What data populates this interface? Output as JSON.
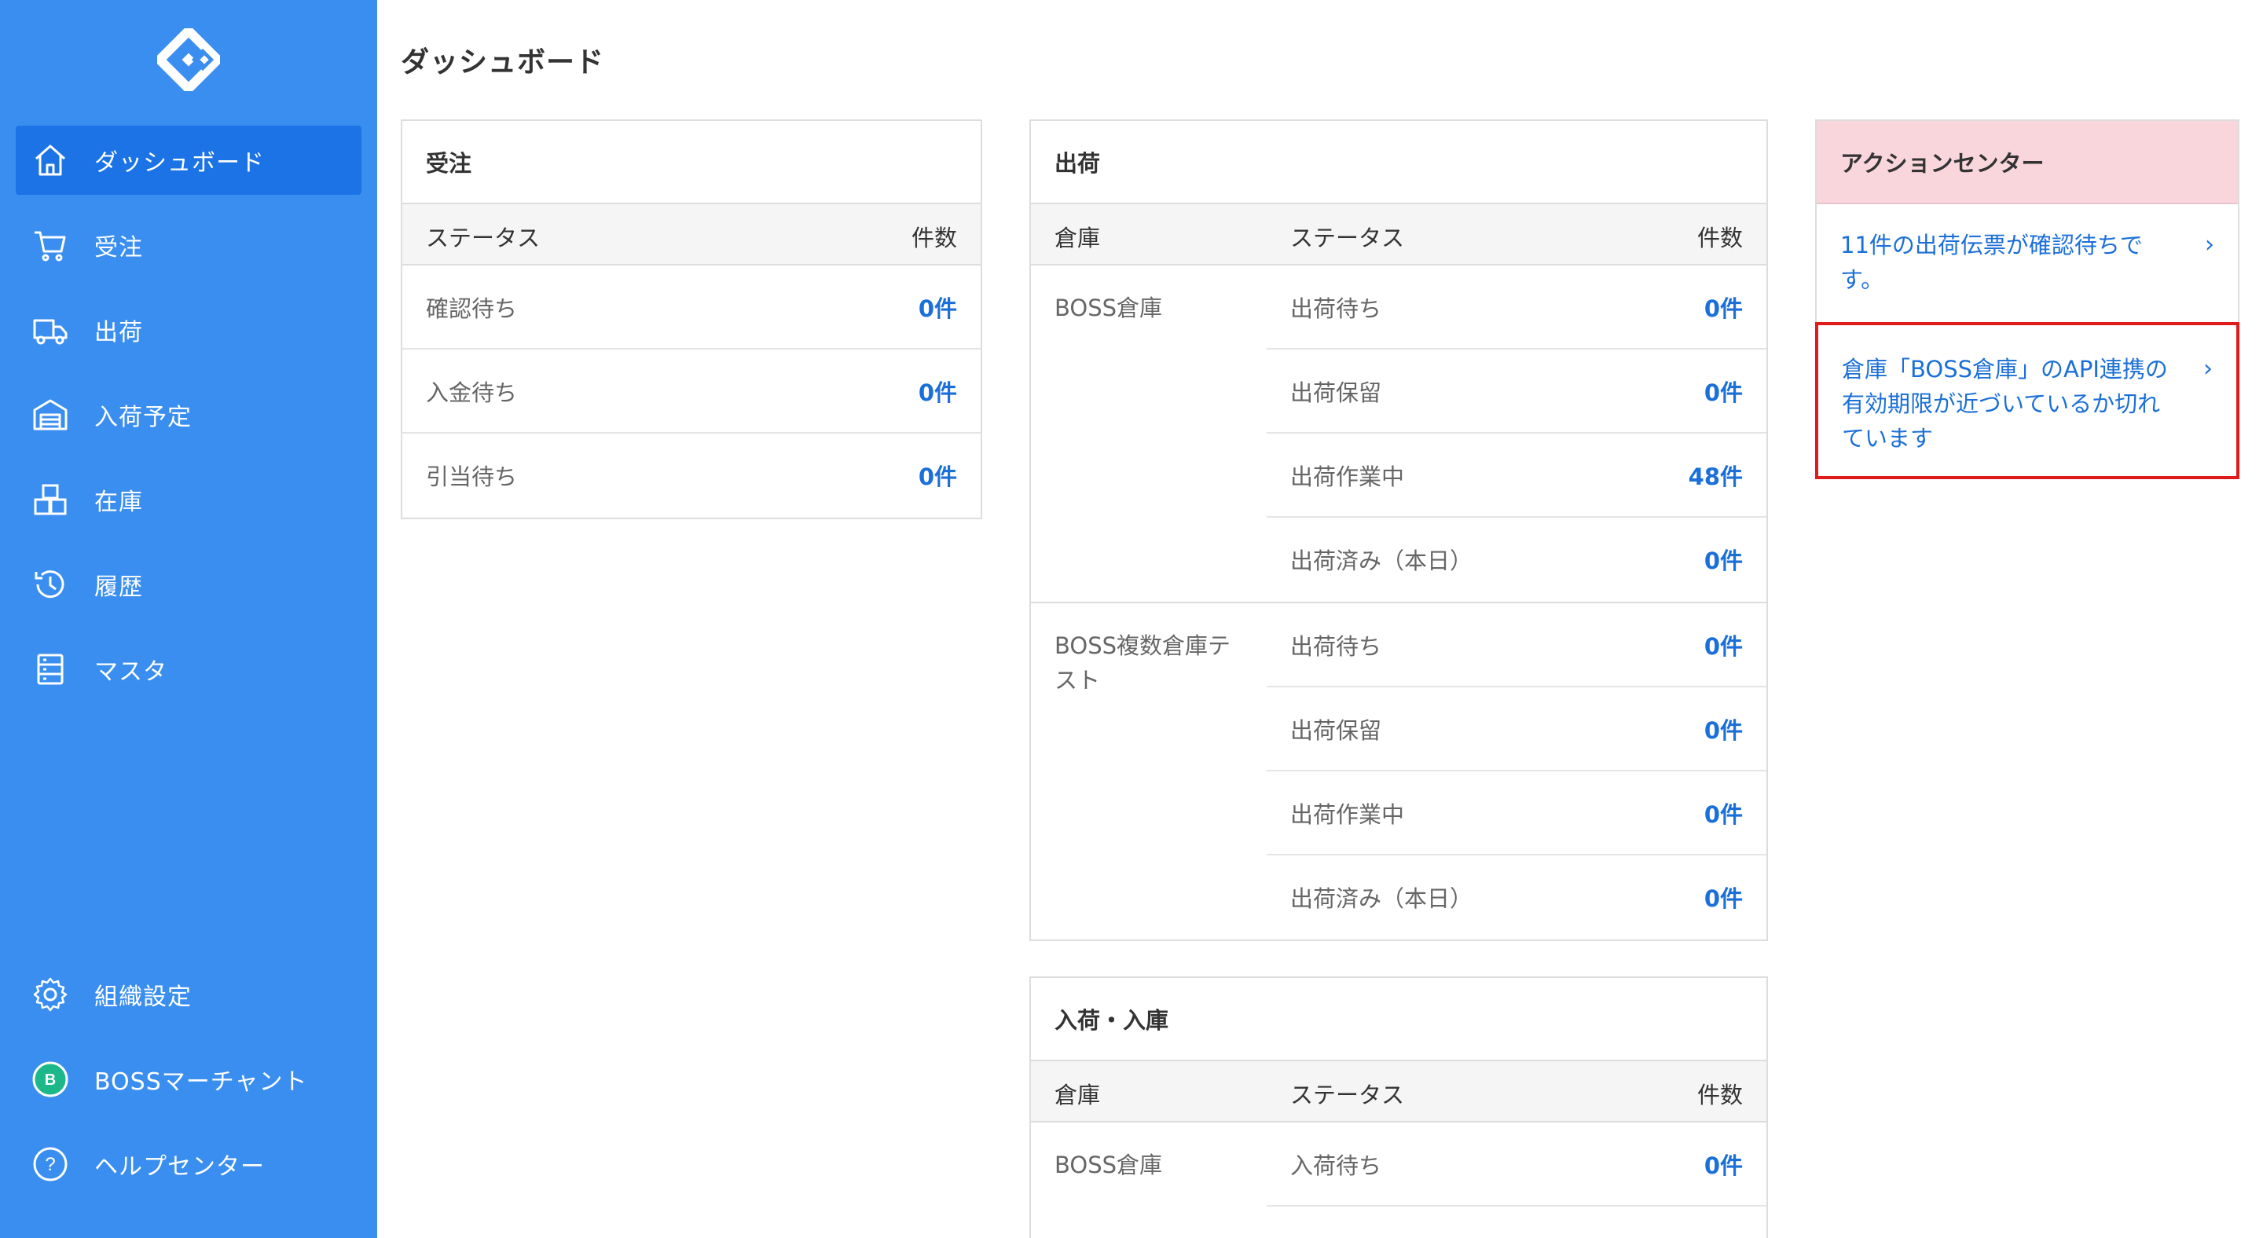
{
  "page": {
    "title": "ダッシュボード"
  },
  "sidebar": {
    "items": [
      {
        "label": "ダッシュボード",
        "icon": "home-icon"
      },
      {
        "label": "受注",
        "icon": "cart-icon"
      },
      {
        "label": "出荷",
        "icon": "truck-icon"
      },
      {
        "label": "入荷予定",
        "icon": "warehouse-icon"
      },
      {
        "label": "在庫",
        "icon": "boxes-icon"
      },
      {
        "label": "履歴",
        "icon": "history-icon"
      },
      {
        "label": "マスタ",
        "icon": "master-icon"
      }
    ],
    "bottom": [
      {
        "label": "組織設定",
        "icon": "gear-icon"
      },
      {
        "label": "BOSSマーチャント",
        "icon": "merchant-avatar-icon",
        "avatar_letter": "B"
      },
      {
        "label": "ヘルプセンター",
        "icon": "help-icon",
        "glyph": "?"
      }
    ]
  },
  "orders": {
    "title": "受注",
    "col_status": "ステータス",
    "col_count": "件数",
    "rows": [
      {
        "label": "確認待ち",
        "value": "0件"
      },
      {
        "label": "入金待ち",
        "value": "0件"
      },
      {
        "label": "引当待ち",
        "value": "0件"
      }
    ]
  },
  "shipping": {
    "title": "出荷",
    "col_warehouse": "倉庫",
    "col_status": "ステータス",
    "col_count": "件数",
    "groups": [
      {
        "warehouse": "BOSS倉庫",
        "rows": [
          {
            "label": "出荷待ち",
            "value": "0件"
          },
          {
            "label": "出荷保留",
            "value": "0件"
          },
          {
            "label": "出荷作業中",
            "value": "48件"
          },
          {
            "label": "出荷済み（本日）",
            "value": "0件"
          }
        ]
      },
      {
        "warehouse": "BOSS複数倉庫テスト",
        "rows": [
          {
            "label": "出荷待ち",
            "value": "0件"
          },
          {
            "label": "出荷保留",
            "value": "0件"
          },
          {
            "label": "出荷作業中",
            "value": "0件"
          },
          {
            "label": "出荷済み（本日）",
            "value": "0件"
          }
        ]
      }
    ]
  },
  "receiving": {
    "title": "入荷・入庫",
    "col_warehouse": "倉庫",
    "col_status": "ステータス",
    "col_count": "件数",
    "groups": [
      {
        "warehouse": "BOSS倉庫",
        "rows": [
          {
            "label": "入荷待ち",
            "value": "0件"
          }
        ]
      }
    ]
  },
  "action_center": {
    "title": "アクションセンター",
    "items": [
      {
        "text": "11件の出荷伝票が確認待ちです。"
      },
      {
        "text": "倉庫「BOSS倉庫」のAPI連携の有効期限が近づいているか切れています"
      }
    ],
    "chevron": "›"
  },
  "colors": {
    "sidebar": "#3a8ef0",
    "sidebar_active": "#1b73e6",
    "link": "#1b6fd8",
    "action_header": "#f9d5dc",
    "highlight_border": "#e01b1b",
    "merchant_avatar": "#1db88a"
  }
}
